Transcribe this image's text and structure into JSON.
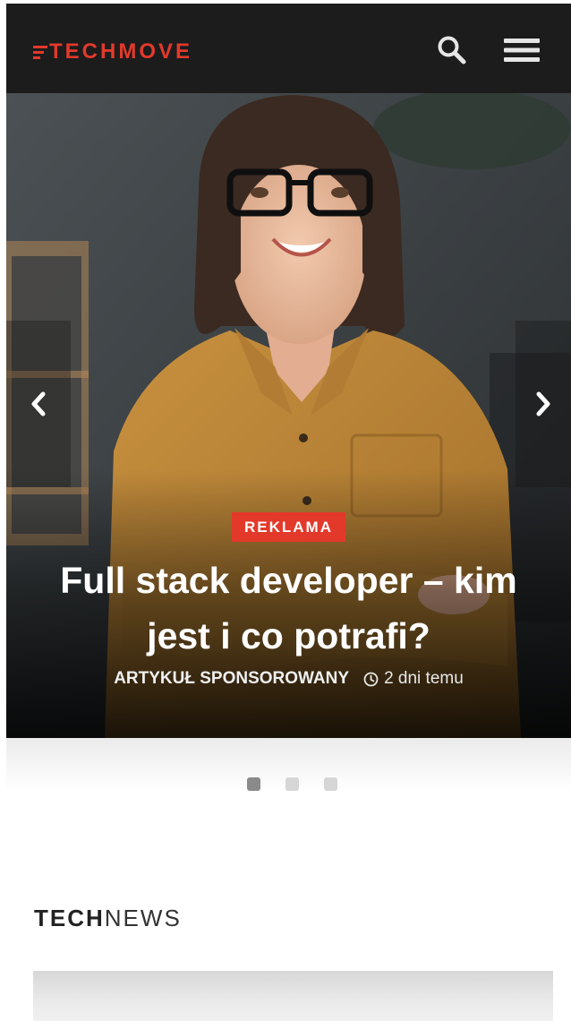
{
  "header": {
    "logo_text": "TECHMOVE",
    "brand_color": "#e3392b",
    "search_icon": "search-icon",
    "menu_icon": "hamburger-menu-icon"
  },
  "hero": {
    "category": "REKLAMA",
    "title": "Full stack developer – kim jest i co potrafi?",
    "author": "ARTYKUŁ SPONSOROWANY",
    "date": "2 dni temu",
    "prev_icon": "chevron-left-icon",
    "next_icon": "chevron-right-icon"
  },
  "slider": {
    "dots": 3,
    "active_index": 0
  },
  "section": {
    "title_bold": "TECH",
    "title_light": "NEWS"
  }
}
